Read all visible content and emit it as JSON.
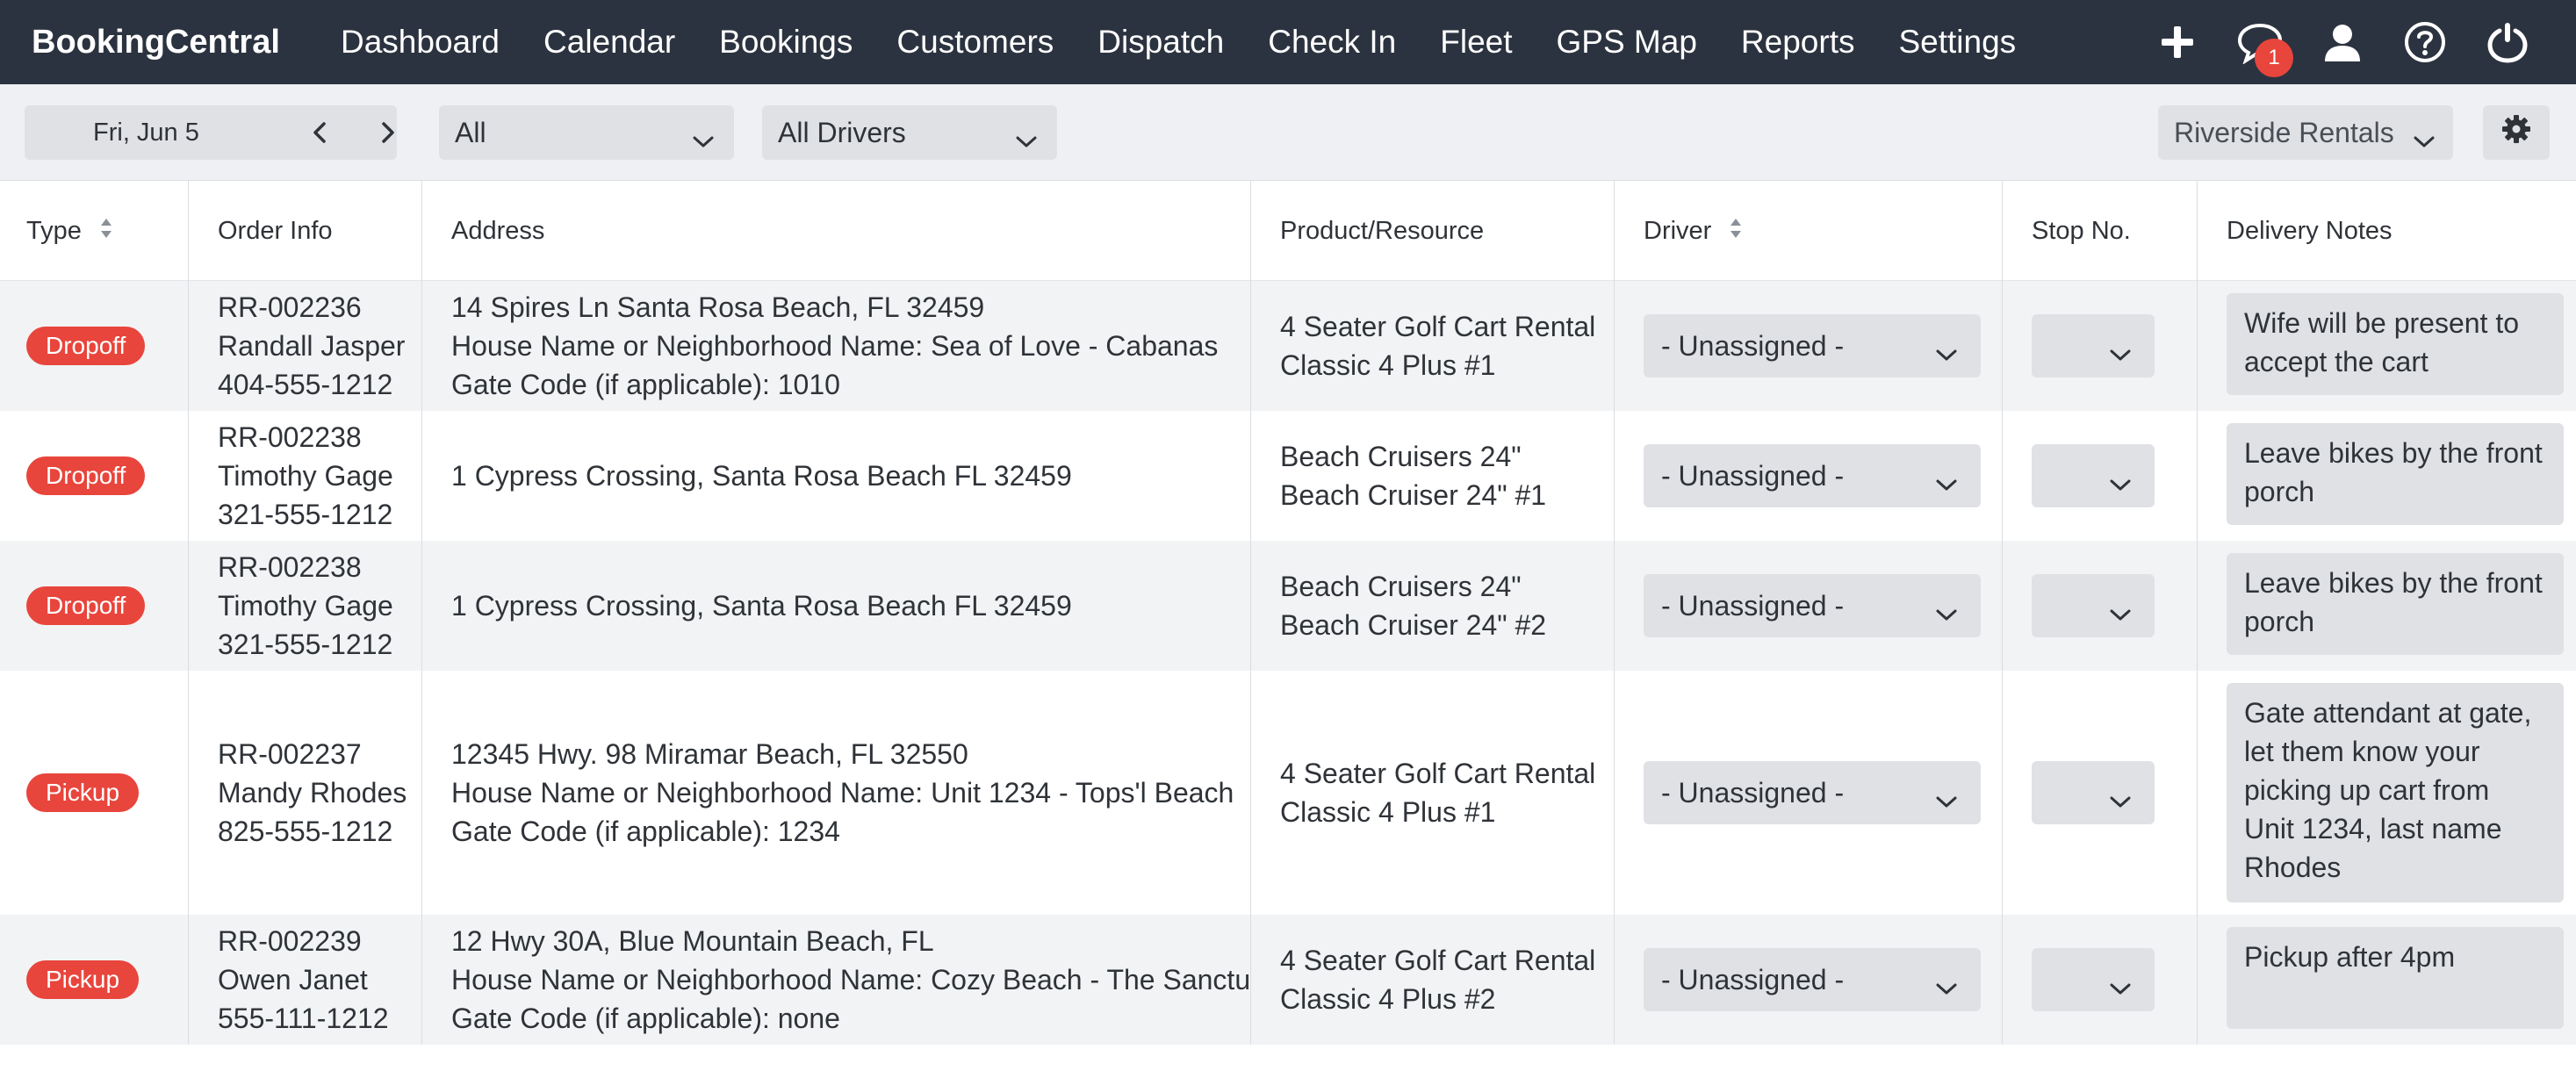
{
  "app": {
    "brand": "BookingCentral",
    "nav": [
      "Dashboard",
      "Calendar",
      "Bookings",
      "Customers",
      "Dispatch",
      "Check In",
      "Fleet",
      "GPS Map",
      "Reports",
      "Settings"
    ],
    "icons": [
      "plus-icon",
      "chat-icon",
      "user-icon",
      "help-icon",
      "power-icon"
    ],
    "chat_badge": "1"
  },
  "toolbar": {
    "date": "Fri, Jun 5",
    "type_filter": "All",
    "driver_filter": "All Drivers",
    "location": "Riverside Rentals"
  },
  "table": {
    "headers": [
      "Type",
      "Order Info",
      "Address",
      "Product/Resource",
      "Driver",
      "Stop No.",
      "Delivery Notes"
    ],
    "rows": [
      {
        "type": "Dropoff",
        "order": [
          "RR-002236",
          "Randall Jasper",
          "404-555-1212"
        ],
        "address": [
          "14 Spires Ln Santa Rosa Beach, FL 32459",
          "House Name or Neighborhood Name: Sea of Love - Cabanas",
          "Gate Code (if applicable): 1010"
        ],
        "product": [
          "4 Seater Golf Cart Rental",
          "Classic 4 Plus #1"
        ],
        "driver": "- Unassigned -",
        "stop": "",
        "notes": "Wife will be present to accept the cart"
      },
      {
        "type": "Dropoff",
        "order": [
          "RR-002238",
          "Timothy Gage",
          "321-555-1212"
        ],
        "address": [
          "1 Cypress Crossing, Santa Rosa Beach FL 32459"
        ],
        "product": [
          "Beach Cruisers 24\"",
          "Beach Cruiser 24\" #1"
        ],
        "driver": "- Unassigned -",
        "stop": "",
        "notes": "Leave bikes by the front porch"
      },
      {
        "type": "Dropoff",
        "order": [
          "RR-002238",
          "Timothy Gage",
          "321-555-1212"
        ],
        "address": [
          "1 Cypress Crossing, Santa Rosa Beach FL 32459"
        ],
        "product": [
          "Beach Cruisers 24\"",
          "Beach Cruiser 24\" #2"
        ],
        "driver": "- Unassigned -",
        "stop": "",
        "notes": "Leave bikes by the front porch"
      },
      {
        "type": "Pickup",
        "order": [
          "RR-002237",
          "Mandy Rhodes",
          "825-555-1212"
        ],
        "address": [
          "12345 Hwy. 98 Miramar Beach, FL 32550",
          "House Name or Neighborhood Name: Unit 1234 - Tops'l Beach",
          "Gate Code (if applicable): 1234"
        ],
        "product": [
          "4 Seater Golf Cart Rental",
          "Classic 4 Plus #1"
        ],
        "driver": "- Unassigned -",
        "stop": "",
        "notes": "Gate attendant at gate, let them know your picking up cart from Unit 1234, last name Rhodes"
      },
      {
        "type": "Pickup",
        "order": [
          "RR-002239",
          "Owen Janet",
          "555-111-1212"
        ],
        "address": [
          "12 Hwy 30A, Blue Mountain Beach, FL",
          "House Name or Neighborhood Name: Cozy Beach - The Sanctuary",
          "Gate Code (if applicable): none"
        ],
        "product": [
          "4 Seater Golf Cart Rental",
          "Classic 4 Plus #2"
        ],
        "driver": "- Unassigned -",
        "stop": "",
        "notes": "Pickup after 4pm"
      }
    ]
  }
}
